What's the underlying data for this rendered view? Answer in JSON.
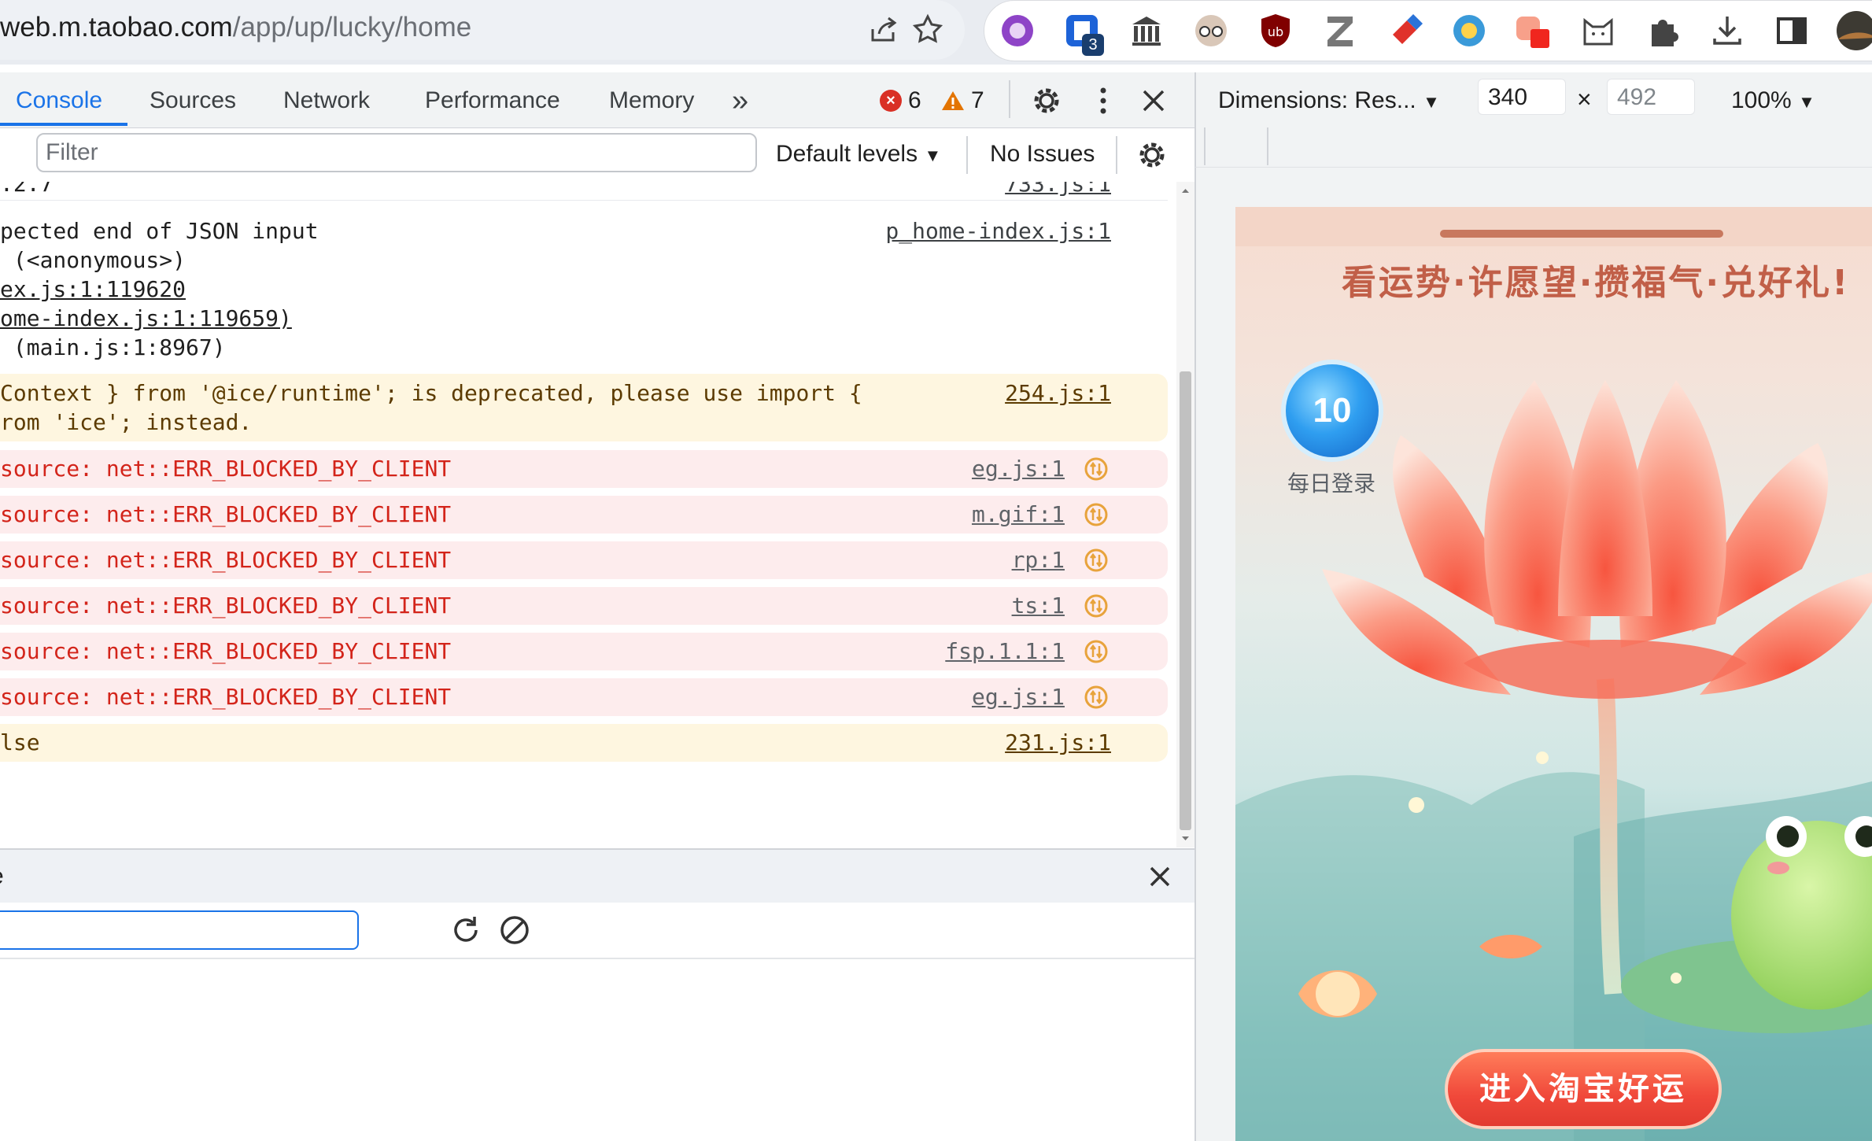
{
  "browser": {
    "url_host": "web.m.taobao.com",
    "url_path": "/app/up/lucky/home",
    "extension_badge": "3",
    "icons": [
      "share-icon",
      "star-icon",
      "extension-purple-icon",
      "extension-blue-icon",
      "extension-library-icon",
      "extension-glasses-icon",
      "ublock-icon",
      "zotero-icon",
      "extension-eraser-icon",
      "extension-globe-icon",
      "extension-orange-icon",
      "extension-cat-icon",
      "extensions-puzzle-icon",
      "download-icon",
      "side-panel-icon",
      "profile-avatar"
    ]
  },
  "devtools": {
    "tabs": [
      "Console",
      "Sources",
      "Network",
      "Performance",
      "Memory"
    ],
    "more_tabs": "»",
    "errors_count": "6",
    "warnings_count": "7",
    "error_color": "#d93025",
    "warning_color": "#e37400",
    "accent": "#1a73e8"
  },
  "device_toolbar": {
    "dimensions_label": "Dimensions: Res...",
    "width": "340",
    "height": "492",
    "times": "×",
    "zoom": "100%"
  },
  "console": {
    "filter_placeholder": "Filter",
    "levels": "Default levels",
    "issues": "No Issues",
    "messages": [
      {
        "type": "info",
        "lines": [
          ".2.7"
        ],
        "source": "733.js:1"
      },
      {
        "type": "info",
        "lines": [
          "pected end of JSON input",
          " (<anonymous>)",
          "ex.js:1:119620",
          "ome-index.js:1:119659)",
          " (main.js:1:8967)"
        ],
        "source": "p_home-index.js:1"
      },
      {
        "type": "warn",
        "lines": [
          "Context } from '@ice/runtime'; is deprecated, please use import {",
          "rom 'ice'; instead."
        ],
        "source": "254.js:1"
      },
      {
        "type": "error",
        "lines": [
          "source: net::ERR_BLOCKED_BY_CLIENT"
        ],
        "source": "eg.js:1"
      },
      {
        "type": "error",
        "lines": [
          "source: net::ERR_BLOCKED_BY_CLIENT"
        ],
        "source": "m.gif:1"
      },
      {
        "type": "error",
        "lines": [
          "source: net::ERR_BLOCKED_BY_CLIENT"
        ],
        "source": "rp:1"
      },
      {
        "type": "error",
        "lines": [
          "source: net::ERR_BLOCKED_BY_CLIENT"
        ],
        "source": "ts:1"
      },
      {
        "type": "error",
        "lines": [
          "source: net::ERR_BLOCKED_BY_CLIENT"
        ],
        "source": "fsp.1.1:1"
      },
      {
        "type": "error",
        "lines": [
          "source: net::ERR_BLOCKED_BY_CLIENT"
        ],
        "source": "eg.js:1"
      },
      {
        "type": "warn",
        "lines": [
          "lse"
        ],
        "source": "231.js:1"
      }
    ]
  },
  "drawer": {
    "title": "e"
  },
  "phone": {
    "subtitle": "看运势·许愿望·攒福气·兑好礼!",
    "login_count": "10",
    "login_label": "每日登录",
    "cta": "进入淘宝好运"
  }
}
